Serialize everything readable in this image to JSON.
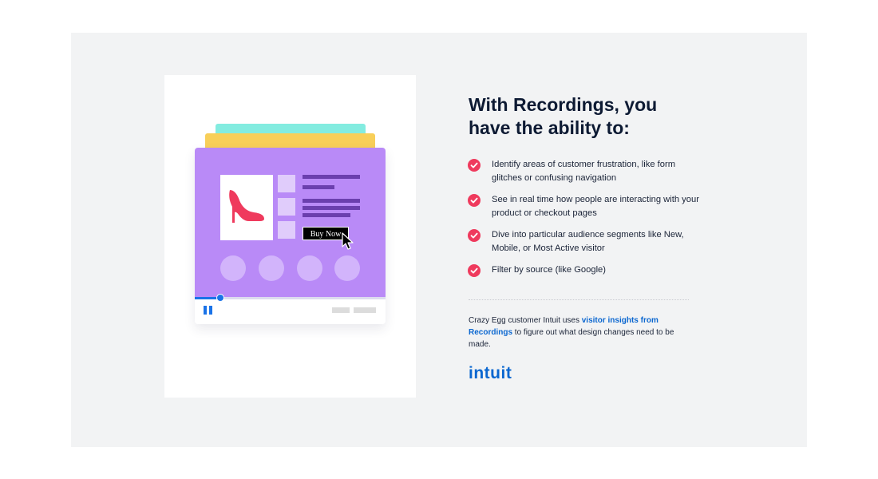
{
  "illustration": {
    "buy_button_label": "Buy Now",
    "colors": {
      "tab_top": "#83ece0",
      "tab_mid": "#f8cf59",
      "screen": "#b98af7",
      "shoe": "#ef3a5d",
      "progress": "#1a73e8"
    },
    "icons": [
      "shoe-icon",
      "cursor-icon",
      "pause-icon"
    ]
  },
  "heading": "With Recordings, you have the ability to:",
  "features": [
    {
      "text": "Identify areas of customer frustration, like form glitches or confusing navigation",
      "icon": "check-icon"
    },
    {
      "text": "See in real time how people are interacting with your product or checkout pages",
      "icon": "check-icon"
    },
    {
      "text": "Dive into particular audience segments like New, Mobile, or Most Active visitor",
      "icon": "check-icon"
    },
    {
      "text": "Filter by source (like Google)",
      "icon": "check-icon"
    }
  ],
  "note": {
    "before": "Crazy Egg customer Intuit uses ",
    "link": "visitor insights from Recordings",
    "after": " to figure out what design changes need to be made."
  },
  "logo": {
    "text": "intuit",
    "color": "#0b67d0"
  },
  "accent_color": "#ef3a5d"
}
